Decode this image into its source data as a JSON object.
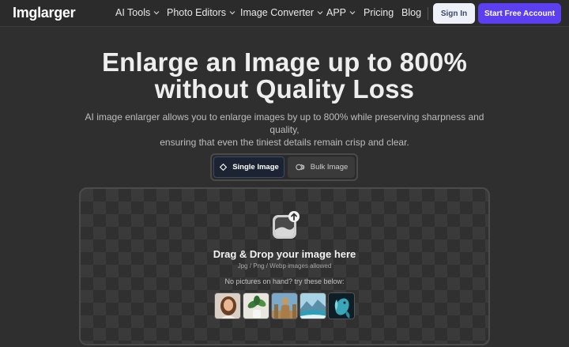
{
  "nav": {
    "logo": "Imglarger",
    "items": [
      {
        "label": "AI Tools",
        "dropdown": true
      },
      {
        "label": "Photo Editors",
        "dropdown": true
      },
      {
        "label": "Image Converter",
        "dropdown": true
      },
      {
        "label": "APP",
        "dropdown": true
      },
      {
        "label": "Pricing",
        "dropdown": false
      },
      {
        "label": "Blog",
        "dropdown": false
      }
    ],
    "sign_in": "Sign In",
    "start": "Start Free Account"
  },
  "hero": {
    "title_line1": "Enlarge an Image up to 800%",
    "title_line2": "without Quality Loss",
    "subtitle_line1": "AI image enlarger allows you to enlarge images by up to 800% while preserving sharpness and quality,",
    "subtitle_line2": "ensuring that even the tiniest details remain crisp and clear."
  },
  "mode": {
    "single": "Single Image",
    "bulk": "Bulk Image",
    "selected": "single"
  },
  "dropzone": {
    "title": "Drag & Drop your image here",
    "formats": "Jpg / Png / Webp images allowed",
    "try_text": "No pictures on hand? try these below:",
    "samples": [
      "portrait-sample",
      "plant-sample",
      "statue-sample",
      "landscape-sample",
      "fish-sample"
    ]
  },
  "colors": {
    "accent": "#5b3ff0",
    "background": "#2f2f2f"
  }
}
